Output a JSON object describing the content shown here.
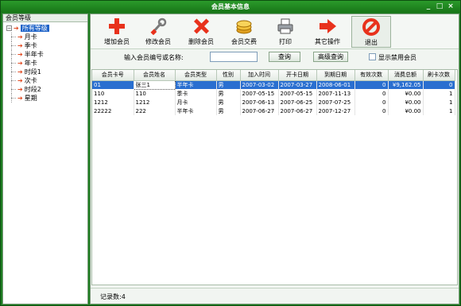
{
  "window": {
    "title": "会员基本信息",
    "min_glyph": "_",
    "max_glyph": "□",
    "close_glyph": "×"
  },
  "tree": {
    "header": "会员等级",
    "expander": "−",
    "root": "所有等级",
    "items": [
      {
        "label": "月卡"
      },
      {
        "label": "季卡"
      },
      {
        "label": "半年卡"
      },
      {
        "label": "年卡"
      },
      {
        "label": "时段1"
      },
      {
        "label": "次卡"
      },
      {
        "label": "时段2"
      },
      {
        "label": "星期"
      }
    ]
  },
  "toolbar": {
    "add": "增加会员",
    "edit": "修改会员",
    "delete": "删除会员",
    "fee": "会员交费",
    "print": "打印",
    "other": "其它操作",
    "exit": "退出"
  },
  "search": {
    "label": "输入会员编号或名称:",
    "value": "",
    "query": "查询",
    "advanced": "高级查询",
    "show_disabled": "显示禁用会员",
    "show_disabled_checked": false
  },
  "table": {
    "columns": [
      "会员卡号",
      "会员姓名",
      "会员类型",
      "性别",
      "加入时间",
      "开卡日期",
      "到期日期",
      "有效次数",
      "消费总额",
      "刷卡次数"
    ],
    "rows": [
      {
        "card": "01",
        "name": "张三1",
        "type": "半年卡",
        "gender": "男",
        "join": "2007-03-02",
        "open": "2007-03-27",
        "expire": "2008-06-01",
        "count": "0",
        "total": "¥9,162.05",
        "swipes": "0",
        "selected": true
      },
      {
        "card": "110",
        "name": "110",
        "type": "季卡",
        "gender": "男",
        "join": "2007-05-15",
        "open": "2007-05-15",
        "expire": "2007-11-13",
        "count": "0",
        "total": "¥0.00",
        "swipes": "1"
      },
      {
        "card": "1212",
        "name": "1212",
        "type": "月卡",
        "gender": "男",
        "join": "2007-06-13",
        "open": "2007-06-25",
        "expire": "2007-07-25",
        "count": "0",
        "total": "¥0.00",
        "swipes": "1"
      },
      {
        "card": "22222",
        "name": "222",
        "type": "半年卡",
        "gender": "男",
        "join": "2007-06-27",
        "open": "2007-06-27",
        "expire": "2007-12-27",
        "count": "0",
        "total": "¥0.00",
        "swipes": "1"
      }
    ]
  },
  "status": {
    "record_count": "记录数:4"
  },
  "colors": {
    "window_green": "#1f7f22",
    "selection_blue": "#2a6fd0",
    "accent_red": "#e8321c"
  }
}
